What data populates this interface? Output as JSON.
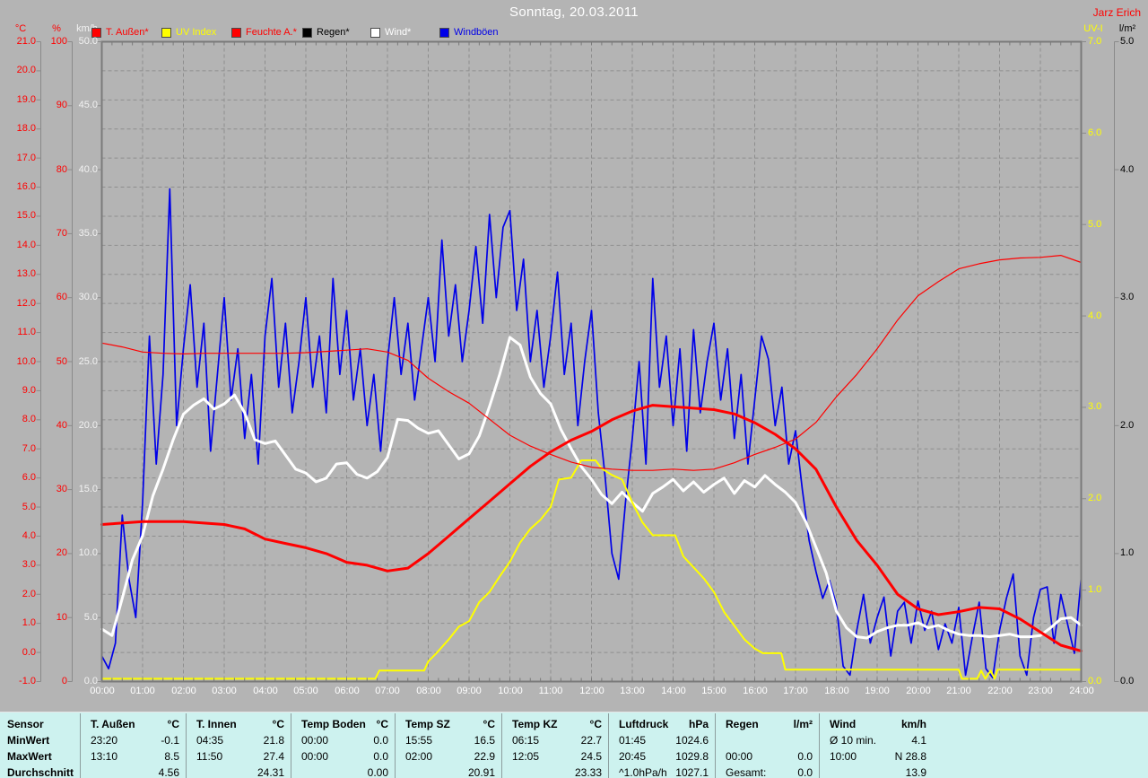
{
  "header": {
    "title": "Sonntag, 20.03.2011",
    "author": "Jarz Erich"
  },
  "chart_data": {
    "type": "line",
    "title": "Sonntag, 20.03.2011",
    "grid": "dashed, hourly vertical + 1.0 °C horizontal",
    "x_axis": {
      "label": "time",
      "ticks": [
        "00:00",
        "01:00",
        "02:00",
        "03:00",
        "04:00",
        "05:00",
        "06:00",
        "07:00",
        "08:00",
        "09:00",
        "10:00",
        "11:00",
        "12:00",
        "13:00",
        "14:00",
        "15:00",
        "16:00",
        "17:00",
        "18:00",
        "19:00",
        "20:00",
        "21:00",
        "22:00",
        "23:00",
        "24:00"
      ]
    },
    "axes": {
      "left": [
        {
          "id": "temp",
          "title": "°C",
          "color": "#ff0000",
          "max": 21,
          "min": -1,
          "step": 1,
          "decimals": 1
        },
        {
          "id": "pct",
          "title": "%",
          "color": "#ff0000",
          "max": 100,
          "min": 0,
          "step": 10,
          "decimals": 0
        },
        {
          "id": "wind",
          "title": "km/h",
          "color": "#f2f2f2",
          "max": 50,
          "min": 0,
          "step": 5,
          "decimals": 1
        }
      ],
      "right": [
        {
          "id": "uv",
          "title": "UV-I",
          "color": "#ffff00",
          "max": 7,
          "min": 0,
          "step": 1,
          "decimals": 1
        },
        {
          "id": "rain",
          "title": "l/m²",
          "color": "#000000",
          "max": 5,
          "min": 0,
          "step": 1,
          "decimals": 1
        }
      ]
    },
    "legend": [
      {
        "label": "T. Außen*",
        "color": "#ff0000"
      },
      {
        "label": "UV Index",
        "color": "#ffff00"
      },
      {
        "label": "Feuchte A.*",
        "color": "#ff0000"
      },
      {
        "label": "Regen*",
        "color": "#000000"
      },
      {
        "label": "Wind*",
        "color": "#ffffff"
      },
      {
        "label": "Windböen",
        "color": "#0000e8"
      }
    ],
    "series": [
      {
        "name": "Regen",
        "axis": "rain",
        "color": "#000000",
        "width": 2,
        "start_h": 0,
        "step_h": 1,
        "values": [
          0,
          0,
          0,
          0,
          0,
          0,
          0,
          0,
          0,
          0,
          0,
          0,
          0,
          0,
          0,
          0,
          0,
          0,
          0,
          0,
          0,
          0,
          0,
          0,
          0
        ]
      },
      {
        "name": "Windböen",
        "axis": "wind",
        "color": "#0000e8",
        "width": 1.7,
        "start_h": 0,
        "step_h": 0.1666667,
        "values": [
          2,
          1,
          3,
          13,
          8,
          5,
          14,
          27,
          17,
          24,
          38.5,
          20,
          26,
          31,
          23,
          28,
          18,
          24,
          30,
          22,
          26,
          19,
          24,
          17,
          27,
          31.5,
          23,
          28,
          21,
          25,
          30,
          23,
          27,
          21,
          31.5,
          24,
          29,
          22,
          26,
          20,
          24,
          18,
          25,
          30,
          24,
          28,
          22,
          26,
          30,
          25,
          34.5,
          27,
          31,
          25,
          29,
          34,
          28,
          36.5,
          30,
          35.5,
          36.8,
          29,
          33,
          25,
          29,
          23,
          27,
          32,
          24,
          28,
          20,
          25,
          29,
          21,
          16,
          10,
          8,
          14,
          19,
          25,
          17,
          31.5,
          23,
          27,
          20,
          26,
          18,
          27.5,
          21,
          25,
          28,
          22,
          26,
          19,
          24,
          17,
          22,
          27,
          25.2,
          20,
          23,
          17,
          19.6,
          15,
          11,
          8.6,
          6.5,
          7.9,
          6,
          1.2,
          0.5,
          4,
          6.8,
          3,
          5,
          6.6,
          2,
          5.5,
          6.2,
          3,
          6.3,
          4,
          5.5,
          2.5,
          4.5,
          3,
          5.8,
          0.5,
          3.5,
          6.2,
          1,
          0.3,
          4,
          6.5,
          8.4,
          2,
          0.5,
          5,
          7.2,
          7.4,
          3,
          6.8,
          4.5,
          2.2,
          8.1
        ]
      },
      {
        "name": "Wind",
        "axis": "wind",
        "color": "#ffffff",
        "width": 3,
        "start_h": 0,
        "step_h": 0.25,
        "values": [
          4.1,
          3.6,
          6.5,
          9.5,
          11.4,
          14.5,
          16.6,
          18.9,
          20.9,
          21.6,
          22.1,
          21.3,
          21.7,
          22.4,
          21.0,
          18.9,
          18.6,
          18.8,
          17.7,
          16.6,
          16.3,
          15.6,
          15.9,
          17.0,
          17.1,
          16.2,
          15.9,
          16.4,
          17.5,
          20.5,
          20.4,
          19.8,
          19.4,
          19.6,
          18.5,
          17.4,
          17.8,
          19.2,
          21.5,
          24.0,
          26.9,
          26.3,
          23.8,
          22.5,
          21.7,
          19.7,
          18.2,
          16.8,
          15.8,
          14.6,
          13.9,
          14.8,
          14.0,
          13.3,
          14.7,
          15.2,
          15.8,
          14.9,
          15.6,
          14.8,
          15.4,
          15.9,
          14.7,
          15.7,
          15.2,
          16.1,
          15.4,
          14.8,
          14.0,
          12.5,
          10.5,
          8.5,
          5.5,
          4.2,
          3.5,
          3.4,
          3.9,
          4.2,
          4.4,
          4.4,
          4.6,
          4.2,
          4.4,
          4.0,
          3.7,
          3.6,
          3.6,
          3.5,
          3.6,
          3.7,
          3.5,
          3.5,
          3.6,
          4.2,
          4.9,
          5.0,
          4.4
        ]
      },
      {
        "name": "UV Index",
        "axis": "uv",
        "color": "#ffff00",
        "width": 2,
        "points": [
          [
            0,
            0.03
          ],
          [
            6.7,
            0.03
          ],
          [
            6.8,
            0.12
          ],
          [
            7.9,
            0.12
          ],
          [
            8.0,
            0.22
          ],
          [
            8.2,
            0.31
          ],
          [
            8.5,
            0.46
          ],
          [
            8.75,
            0.6
          ],
          [
            9.0,
            0.66
          ],
          [
            9.25,
            0.87
          ],
          [
            9.5,
            0.98
          ],
          [
            9.75,
            1.15
          ],
          [
            10.0,
            1.31
          ],
          [
            10.25,
            1.52
          ],
          [
            10.5,
            1.67
          ],
          [
            10.75,
            1.77
          ],
          [
            11.0,
            1.91
          ],
          [
            11.2,
            2.21
          ],
          [
            11.5,
            2.23
          ],
          [
            11.75,
            2.42
          ],
          [
            12.1,
            2.42
          ],
          [
            12.25,
            2.33
          ],
          [
            12.5,
            2.26
          ],
          [
            12.75,
            2.21
          ],
          [
            13.0,
            1.96
          ],
          [
            13.25,
            1.74
          ],
          [
            13.5,
            1.6
          ],
          [
            14.05,
            1.6
          ],
          [
            14.25,
            1.37
          ],
          [
            14.5,
            1.25
          ],
          [
            14.75,
            1.13
          ],
          [
            15.0,
            0.98
          ],
          [
            15.25,
            0.76
          ],
          [
            15.5,
            0.61
          ],
          [
            15.75,
            0.46
          ],
          [
            16.0,
            0.36
          ],
          [
            16.2,
            0.31
          ],
          [
            16.65,
            0.31
          ],
          [
            16.75,
            0.13
          ],
          [
            21.0,
            0.13
          ],
          [
            21.08,
            0.03
          ],
          [
            21.45,
            0.03
          ],
          [
            21.55,
            0.12
          ],
          [
            21.65,
            0.03
          ],
          [
            21.78,
            0.12
          ],
          [
            21.88,
            0.03
          ],
          [
            21.95,
            0.13
          ],
          [
            24,
            0.13
          ]
        ]
      },
      {
        "name": "Feuchte A.",
        "axis": "pct",
        "color": "#ff0000",
        "width": 1.2,
        "start_h": 0,
        "step_h": 0.5,
        "values": [
          52.9,
          52.3,
          51.5,
          51.3,
          51.2,
          51.3,
          51.3,
          51.3,
          51.3,
          51.3,
          51.4,
          51.6,
          51.8,
          52.0,
          51.5,
          50.2,
          47.4,
          45.3,
          43.5,
          41.0,
          38.5,
          36.8,
          35.5,
          34.3,
          33.5,
          33.2,
          33.0,
          33.0,
          33.2,
          33.0,
          33.2,
          34.2,
          35.5,
          36.6,
          37.9,
          40.5,
          44.5,
          48.0,
          52.0,
          56.5,
          60.3,
          62.5,
          64.5,
          65.3,
          65.9,
          66.2,
          66.3,
          66.6,
          65.5
        ]
      },
      {
        "name": "T. Außen",
        "axis": "temp",
        "color": "#ff0000",
        "width": 3,
        "start_h": 0,
        "step_h": 0.5,
        "values": [
          4.4,
          4.45,
          4.5,
          4.5,
          4.5,
          4.45,
          4.4,
          4.25,
          3.9,
          3.75,
          3.6,
          3.4,
          3.1,
          3.0,
          2.8,
          2.9,
          3.4,
          4.0,
          4.6,
          5.2,
          5.8,
          6.4,
          6.9,
          7.3,
          7.6,
          8.0,
          8.3,
          8.5,
          8.45,
          8.4,
          8.35,
          8.2,
          7.9,
          7.5,
          7.0,
          6.3,
          5.0,
          3.85,
          3.0,
          2.0,
          1.5,
          1.3,
          1.4,
          1.55,
          1.5,
          1.15,
          0.7,
          0.25,
          0.05
        ]
      }
    ]
  },
  "table": {
    "row_labels": [
      "Sensor",
      "MinWert",
      "MaxWert",
      "Durchschnitt"
    ],
    "columns": [
      {
        "header": "T. Außen",
        "unit": "°C",
        "min": [
          "23:20",
          "-0.1"
        ],
        "max": [
          "13:10",
          "8.5"
        ],
        "avg": [
          "",
          "4.56"
        ]
      },
      {
        "header": "T. Innen",
        "unit": "°C",
        "min": [
          "04:35",
          "21.8"
        ],
        "max": [
          "11:50",
          "27.4"
        ],
        "avg": [
          "",
          "24.31"
        ]
      },
      {
        "header": "Temp Boden",
        "unit": "°C",
        "min": [
          "00:00",
          "0.0"
        ],
        "max": [
          "00:00",
          "0.0"
        ],
        "avg": [
          "",
          "0.00"
        ]
      },
      {
        "header": "Temp SZ",
        "unit": "°C",
        "min": [
          "15:55",
          "16.5"
        ],
        "max": [
          "02:00",
          "22.9"
        ],
        "avg": [
          "",
          "20.91"
        ]
      },
      {
        "header": "Temp KZ",
        "unit": "°C",
        "min": [
          "06:15",
          "22.7"
        ],
        "max": [
          "12:05",
          "24.5"
        ],
        "avg": [
          "",
          "23.33"
        ]
      },
      {
        "header": "Luftdruck",
        "unit": "hPa",
        "min": [
          "01:45",
          "1024.6"
        ],
        "max": [
          "20:45",
          "1029.8"
        ],
        "avg": [
          "^1.0hPa/h",
          "1027.1"
        ]
      },
      {
        "header": "Regen",
        "unit": "l/m²",
        "min": [
          "",
          ""
        ],
        "max": [
          "00:00",
          "0.0"
        ],
        "avg": [
          "Gesamt:",
          "0.0"
        ]
      },
      {
        "header": "Wind",
        "unit": "km/h",
        "min": [
          "Ø 10 min.",
          "4.1"
        ],
        "max": [
          "10:00",
          "N 28.8"
        ],
        "avg": [
          "",
          "13.9"
        ]
      }
    ]
  }
}
